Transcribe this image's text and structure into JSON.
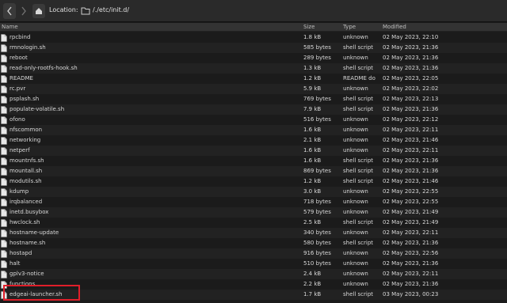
{
  "toolbar": {
    "location_label": "Location:",
    "path": "/./etc/init.d/"
  },
  "columns": {
    "name": "Name",
    "size": "Size",
    "type": "Type",
    "modified": "Modified"
  },
  "files": [
    {
      "name": "rpcbind",
      "size": "1.8 kB",
      "type": "unknown",
      "modified": "02 May 2023, 22:10"
    },
    {
      "name": "rmnologin.sh",
      "size": "585 bytes",
      "type": "shell script",
      "modified": "02 May 2023, 21:36"
    },
    {
      "name": "reboot",
      "size": "289 bytes",
      "type": "unknown",
      "modified": "02 May 2023, 21:36"
    },
    {
      "name": "read-only-rootfs-hook.sh",
      "size": "1.3 kB",
      "type": "shell script",
      "modified": "02 May 2023, 21:36"
    },
    {
      "name": "README",
      "size": "1.2 kB",
      "type": "README do",
      "modified": "02 May 2023, 22:05"
    },
    {
      "name": "rc.pvr",
      "size": "5.9 kB",
      "type": "unknown",
      "modified": "02 May 2023, 22:02"
    },
    {
      "name": "psplash.sh",
      "size": "769 bytes",
      "type": "shell script",
      "modified": "02 May 2023, 22:13"
    },
    {
      "name": "populate-volatile.sh",
      "size": "7.9 kB",
      "type": "shell script",
      "modified": "02 May 2023, 21:36"
    },
    {
      "name": "ofono",
      "size": "516 bytes",
      "type": "unknown",
      "modified": "02 May 2023, 22:12"
    },
    {
      "name": "nfscommon",
      "size": "1.6 kB",
      "type": "unknown",
      "modified": "02 May 2023, 22:11"
    },
    {
      "name": "networking",
      "size": "2.1 kB",
      "type": "unknown",
      "modified": "02 May 2023, 21:46"
    },
    {
      "name": "netperf",
      "size": "1.6 kB",
      "type": "unknown",
      "modified": "02 May 2023, 22:11"
    },
    {
      "name": "mountnfs.sh",
      "size": "1.6 kB",
      "type": "shell script",
      "modified": "02 May 2023, 21:36"
    },
    {
      "name": "mountall.sh",
      "size": "869 bytes",
      "type": "shell script",
      "modified": "02 May 2023, 21:36"
    },
    {
      "name": "modutils.sh",
      "size": "1.2 kB",
      "type": "shell script",
      "modified": "02 May 2023, 21:46"
    },
    {
      "name": "kdump",
      "size": "3.0 kB",
      "type": "unknown",
      "modified": "02 May 2023, 22:55"
    },
    {
      "name": "irqbalanced",
      "size": "718 bytes",
      "type": "unknown",
      "modified": "02 May 2023, 22:55"
    },
    {
      "name": "inetd.busybox",
      "size": "579 bytes",
      "type": "unknown",
      "modified": "02 May 2023, 21:49"
    },
    {
      "name": "hwclock.sh",
      "size": "2.5 kB",
      "type": "shell script",
      "modified": "02 May 2023, 21:49"
    },
    {
      "name": "hostname-update",
      "size": "340 bytes",
      "type": "unknown",
      "modified": "02 May 2023, 22:11"
    },
    {
      "name": "hostname.sh",
      "size": "580 bytes",
      "type": "shell script",
      "modified": "02 May 2023, 21:36"
    },
    {
      "name": "hostapd",
      "size": "916 bytes",
      "type": "unknown",
      "modified": "02 May 2023, 22:56"
    },
    {
      "name": "halt",
      "size": "510 bytes",
      "type": "unknown",
      "modified": "02 May 2023, 21:36"
    },
    {
      "name": "gplv3-notice",
      "size": "2.4 kB",
      "type": "unknown",
      "modified": "02 May 2023, 22:11"
    },
    {
      "name": "functions",
      "size": "2.2 kB",
      "type": "unknown",
      "modified": "02 May 2023, 21:36"
    },
    {
      "name": "edgeai-launcher.sh",
      "size": "1.7 kB",
      "type": "shell script",
      "modified": "03 May 2023, 00:23"
    }
  ],
  "highlighted_file": "edgeai-launcher.sh",
  "colors": {
    "background": "#1b1b1b",
    "highlight_box": "#e01f2a"
  }
}
